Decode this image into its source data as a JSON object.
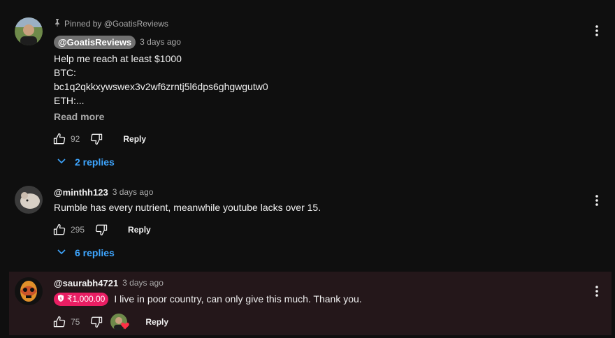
{
  "comments": [
    {
      "pinned_text": "Pinned by @GoatisReviews",
      "author": "@GoatisReviews",
      "time": "3 days ago",
      "text": "Help me reach at least $1000\nBTC:\nbc1q2qkkxywswex3v2wf6zrntj5l6dps6ghgwgutw0\nETH:...",
      "read_more": "Read more",
      "likes": "92",
      "reply_label": "Reply",
      "replies_label": "2 replies"
    },
    {
      "author": "@minthh123",
      "time": "3 days ago",
      "text": "Rumble has every nutrient, meanwhile youtube lacks over 15.",
      "likes": "295",
      "reply_label": "Reply",
      "replies_label": "6 replies"
    },
    {
      "author": "@saurabh4721",
      "time": "3 days ago",
      "donation": "₹1,000.00",
      "text": "I live in poor country, can only give this much. Thank you.",
      "likes": "75",
      "reply_label": "Reply"
    }
  ],
  "colors": {
    "background": "#0f0f0f",
    "link": "#3ea6ff",
    "donation": "#e91e63",
    "highlight_bg": "#24171a"
  },
  "icons": [
    "pin-icon",
    "thumb-up-icon",
    "thumb-down-icon",
    "chevron-down-icon",
    "more-vert-icon",
    "donation-icon",
    "creator-heart-icon"
  ]
}
